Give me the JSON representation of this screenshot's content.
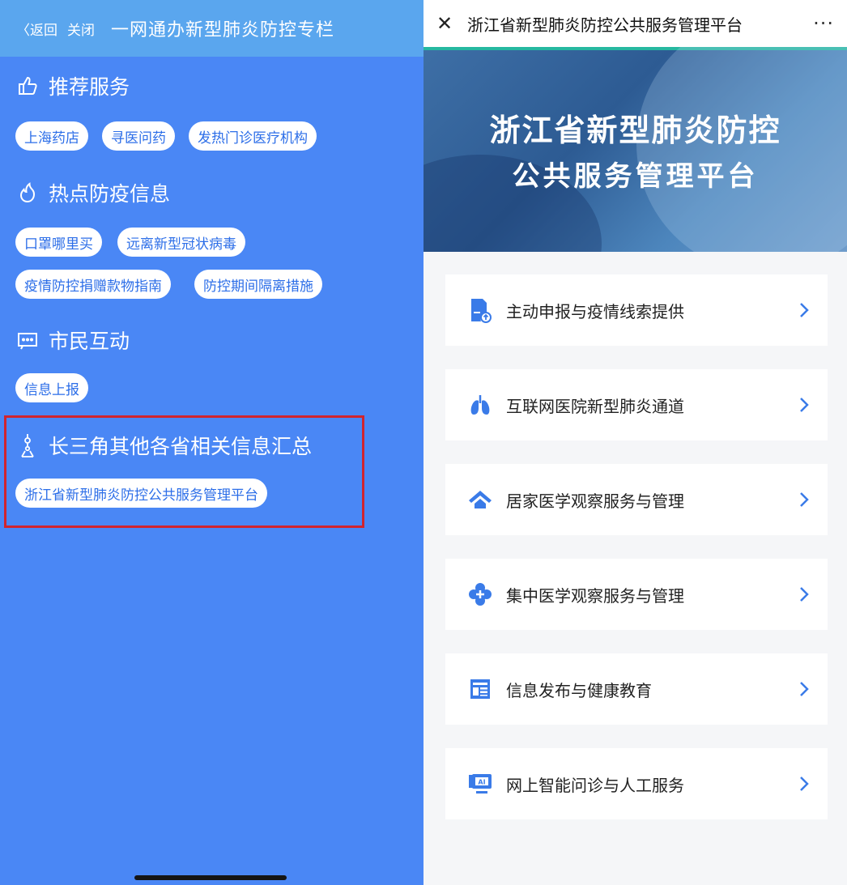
{
  "left": {
    "nav": {
      "back": "〈返回",
      "close": "关闭",
      "title": "一网通办新型肺炎防控专栏"
    },
    "sections": [
      {
        "icon": "thumbs-up-icon",
        "title": "推荐服务",
        "chips": [
          "上海药店",
          "寻医问药",
          "发热门诊医疗机构"
        ]
      },
      {
        "icon": "flame-icon",
        "title": "热点防疫信息",
        "chips": [
          "口罩哪里买",
          "远离新型冠状病毒",
          "疫情防控捐赠款物指南",
          "防控期间隔离措施"
        ]
      },
      {
        "icon": "chat-icon",
        "title": "市民互动",
        "chips": [
          "信息上报"
        ]
      },
      {
        "icon": "tower-icon",
        "title": "长三角其他各省相关信息汇总",
        "chips": [
          "浙江省新型肺炎防控公共服务管理平台"
        ]
      }
    ]
  },
  "right": {
    "nav": {
      "close": "✕",
      "title": "浙江省新型肺炎防控公共服务管理平台",
      "more": "···"
    },
    "banner": {
      "line1": "浙江省新型肺炎防控",
      "line2": "公共服务管理平台"
    },
    "items": [
      {
        "icon": "report-upload-icon",
        "label": "主动申报与疫情线索提供"
      },
      {
        "icon": "lungs-icon",
        "label": "互联网医院新型肺炎通道"
      },
      {
        "icon": "home-icon",
        "label": "居家医学观察服务与管理"
      },
      {
        "icon": "medical-cross-icon",
        "label": "集中医学观察服务与管理"
      },
      {
        "icon": "news-icon",
        "label": "信息发布与健康教育"
      },
      {
        "icon": "ai-monitor-icon",
        "label": "网上智能问诊与人工服务"
      }
    ]
  },
  "colors": {
    "left_bg": "#4a87f5",
    "left_header": "#5aa6ee",
    "accent": "#2c6ee8",
    "highlight": "#d0242e"
  }
}
